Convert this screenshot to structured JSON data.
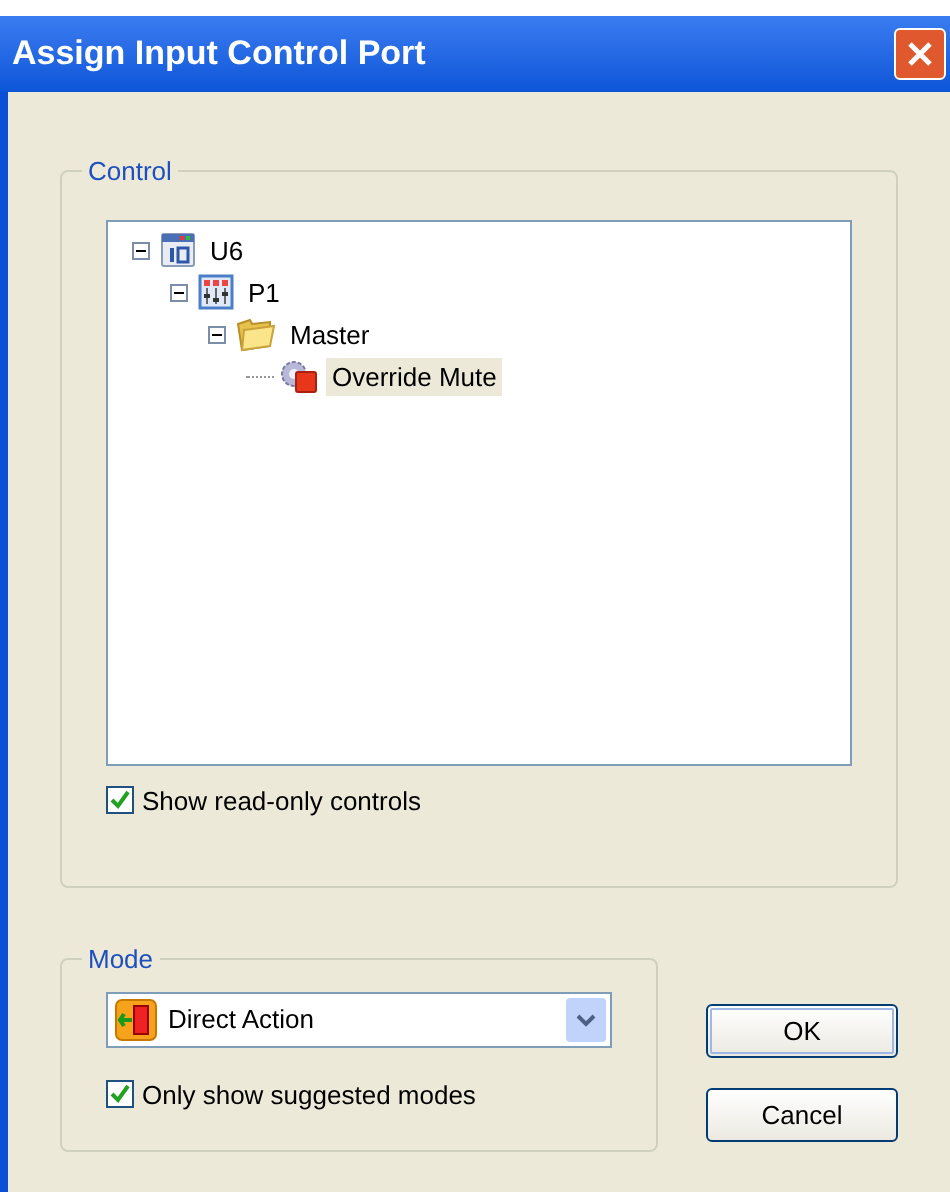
{
  "window": {
    "title": "Assign Input Control Port"
  },
  "control_group": {
    "label": "Control",
    "tree": [
      {
        "label": "U6",
        "kind": "device",
        "expanded": true,
        "selected": false,
        "children": [
          {
            "label": "P1",
            "kind": "processor",
            "expanded": true,
            "selected": false,
            "children": [
              {
                "label": "Master",
                "kind": "folder",
                "expanded": true,
                "selected": false,
                "children": [
                  {
                    "label": "Override Mute",
                    "kind": "control",
                    "selected": true
                  }
                ]
              }
            ]
          }
        ]
      }
    ],
    "show_read_only": {
      "label": "Show read-only controls",
      "checked": true
    }
  },
  "mode_group": {
    "label": "Mode",
    "dropdown": {
      "value": "Direct Action"
    },
    "only_suggested": {
      "label": "Only show suggested modes",
      "checked": true
    }
  },
  "buttons": [
    {
      "label": "OK",
      "default": true
    },
    {
      "label": "Cancel",
      "default": false
    }
  ]
}
